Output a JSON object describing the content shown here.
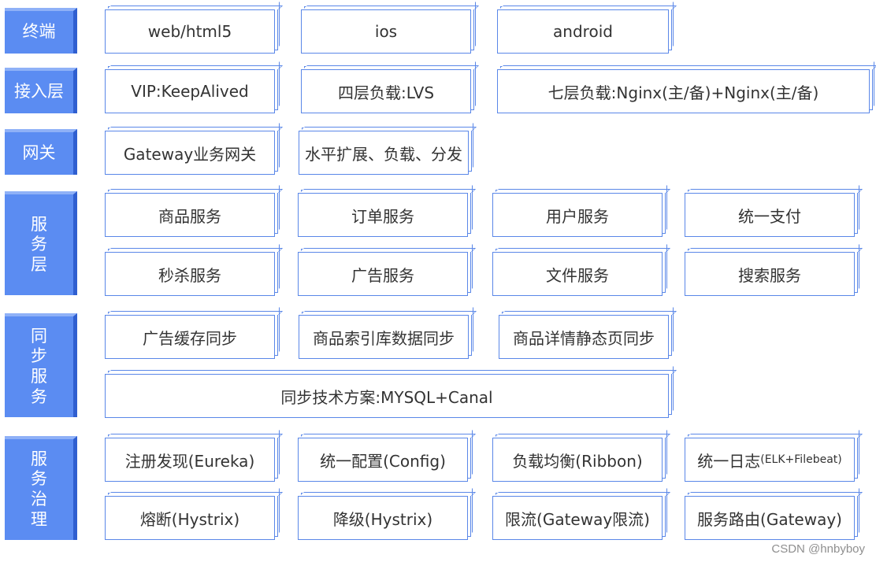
{
  "layers": [
    {
      "label": "终端",
      "items": [
        "web/html5",
        "ios",
        "android"
      ]
    },
    {
      "label": "接入层",
      "items": [
        "VIP:KeepAlived",
        "四层负载:LVS",
        "七层负载:Nginx(主/备)+Nginx(主/备)"
      ]
    },
    {
      "label": "网关",
      "items": [
        "Gateway业务网关",
        "水平扩展、负载、分发"
      ]
    },
    {
      "label_chars": [
        "服",
        "务",
        "层"
      ],
      "items": [
        "商品服务",
        "订单服务",
        "用户服务",
        "统一支付",
        "秒杀服务",
        "广告服务",
        "文件服务",
        "搜索服务"
      ]
    },
    {
      "label_chars": [
        "同",
        "步",
        "服",
        "务"
      ],
      "items": [
        "广告缓存同步",
        "商品索引库数据同步",
        "商品详情静态页同步",
        "同步技术方案:MYSQL+Canal"
      ]
    },
    {
      "label_chars": [
        "服",
        "务",
        "治",
        "理"
      ],
      "items": [
        "注册发现(Eureka)",
        "统一配置(Config)",
        "负载均衡(Ribbon)",
        "统一日志",
        "(ELK+Filebeat)",
        "熔断(Hystrix)",
        "降级(Hystrix)",
        "限流(Gateway限流)",
        "服务路由(Gateway)"
      ]
    }
  ],
  "watermark": "CSDN @hnbyboy",
  "colors": {
    "label_bg": "#5b8cf2",
    "border": "#5a87e8",
    "text": "#333333"
  }
}
